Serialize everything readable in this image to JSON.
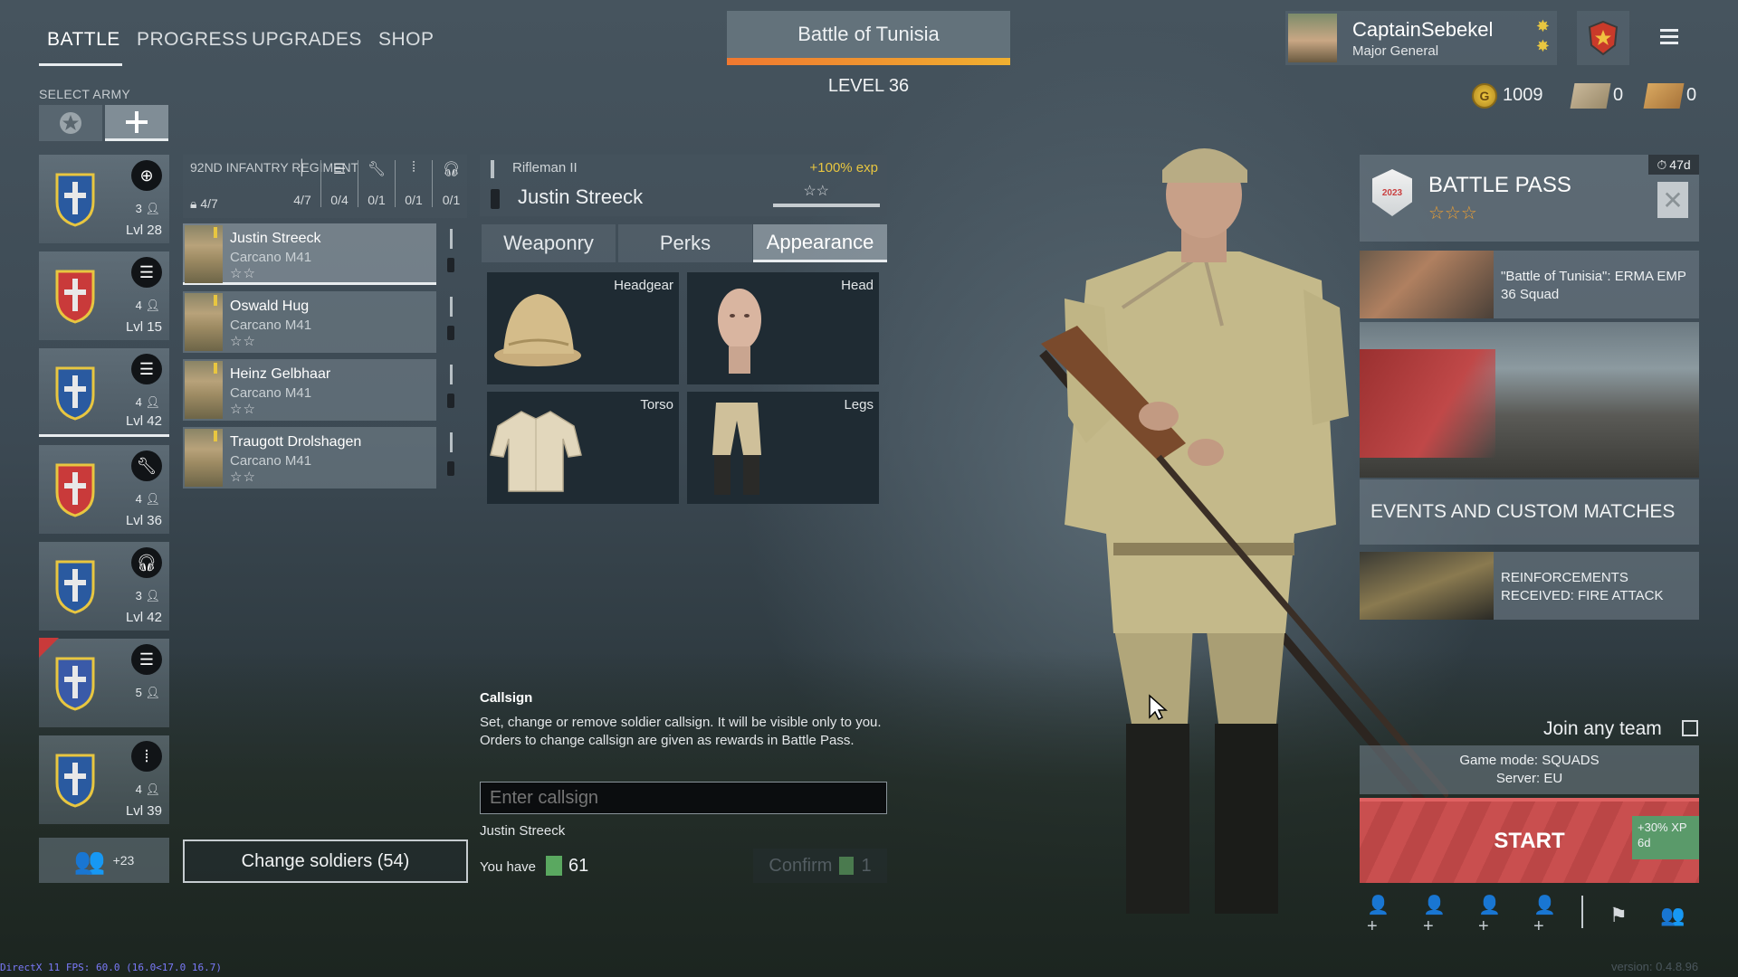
{
  "nav": {
    "tabs": [
      "BATTLE",
      "PROGRESS",
      "UPGRADES",
      "SHOP"
    ],
    "select_army_label": "SELECT ARMY"
  },
  "battle": {
    "name": "Battle of Tunisia",
    "level_label": "LEVEL",
    "level": "36",
    "progress": 1.0
  },
  "profile": {
    "username": "CaptainSebekel",
    "rank": "Major General"
  },
  "currency": {
    "gold": "1009",
    "silver_orders": "0",
    "gold_orders": "0"
  },
  "squads": [
    {
      "role_icon": "crosshair-icon",
      "count": "3",
      "level": "Lvl 28"
    },
    {
      "role_icon": "list-icon",
      "count": "4",
      "level": "Lvl 15"
    },
    {
      "role_icon": "list-icon",
      "count": "4",
      "level": "Lvl 42"
    },
    {
      "role_icon": "wrench-icon",
      "count": "4",
      "level": "Lvl 36"
    },
    {
      "role_icon": "headphones-icon",
      "count": "3",
      "level": "Lvl 42"
    },
    {
      "role_icon": "list-icon",
      "count": "5",
      "level": ""
    },
    {
      "role_icon": "ammo-icon",
      "count": "4",
      "level": "Lvl 39"
    }
  ],
  "squad_extra": "+23",
  "regiment": {
    "name": "92ND INFANTRY REGIMENT",
    "slots_total": "4/7",
    "class_counts": [
      "4/7",
      "0/4",
      "0/1",
      "0/1",
      "0/1"
    ]
  },
  "soldiers": [
    {
      "name": "Justin Streeck",
      "weapon": "Carcano M41",
      "stars": "☆☆"
    },
    {
      "name": "Oswald Hug",
      "weapon": "Carcano M41",
      "stars": "☆☆"
    },
    {
      "name": "Heinz Gelbhaar",
      "weapon": "Carcano M41",
      "stars": "☆☆"
    },
    {
      "name": "Traugott Drolshagen",
      "weapon": "Carcano M41",
      "stars": "☆☆"
    }
  ],
  "change_soldiers_label": "Change soldiers (54)",
  "selected_soldier": {
    "class": "Rifleman II",
    "exp_bonus": "+100% exp",
    "name": "Justin Streeck",
    "stars": "☆☆"
  },
  "detail_tabs": [
    "Weaponry",
    "Perks",
    "Appearance"
  ],
  "appearance_slots": [
    "Headgear",
    "Head",
    "Torso",
    "Legs"
  ],
  "callsign": {
    "title": "Callsign",
    "description": "Set, change or remove soldier callsign. It will be visible only to you. Orders to change callsign are given as rewards in Battle Pass.",
    "placeholder": "Enter callsign",
    "current_name": "Justin Streeck",
    "you_have_label": "You have",
    "you_have_count": "61",
    "confirm_label": "Confirm",
    "confirm_cost": "1"
  },
  "battle_pass": {
    "title": "BATTLE PASS",
    "badge_year": "2023",
    "timer": "47d",
    "stars": "☆☆☆"
  },
  "news": [
    {
      "text": "\"Battle of Tunisia\": ERMA EMP 36 Squad"
    },
    {
      "text": "REINFORCEMENTS RECEIVED: FIRE ATTACK"
    }
  ],
  "events_label": "EVENTS AND CUSTOM MATCHES",
  "join_any_team": "Join any team",
  "game_mode": "Game mode: SQUADS",
  "server": "Server: EU",
  "start": {
    "label": "START",
    "bonus": "+30% XP",
    "bonus_time": "6d"
  },
  "footer": {
    "fps": "DirectX 11 FPS: 60.0 (16.0<17.0 16.7)",
    "version": "version: 0.4.8.96"
  },
  "colors": {
    "accent_orange": "#f0a030",
    "start_red": "#c94f4f",
    "xp_green": "#5a9a6a",
    "exp_yellow": "#e8c640"
  }
}
